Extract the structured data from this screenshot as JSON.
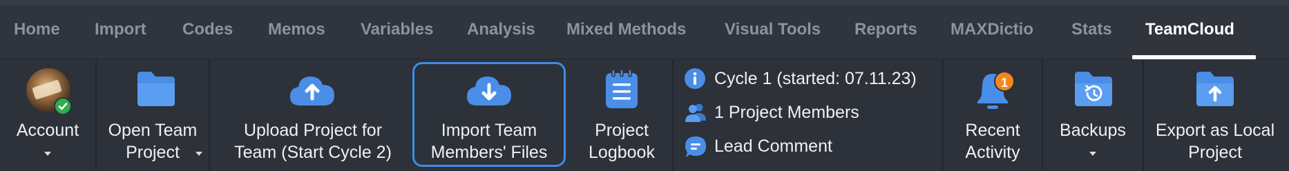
{
  "tabs": [
    {
      "label": "Home",
      "active": false
    },
    {
      "label": "Import",
      "active": false
    },
    {
      "label": "Codes",
      "active": false
    },
    {
      "label": "Memos",
      "active": false
    },
    {
      "label": "Variables",
      "active": false
    },
    {
      "label": "Analysis",
      "active": false
    },
    {
      "label": "Mixed Methods",
      "active": false
    },
    {
      "label": "Visual Tools",
      "active": false
    },
    {
      "label": "Reports",
      "active": false
    },
    {
      "label": "MAXDictio",
      "active": false
    },
    {
      "label": "Stats",
      "active": false
    },
    {
      "label": "TeamCloud",
      "active": true
    }
  ],
  "ribbon": {
    "account": {
      "label": "Account",
      "icon": "user-avatar-icon",
      "status_icon": "check-icon"
    },
    "open_team_project": {
      "line1": "Open Team",
      "line2": "Project",
      "icon": "folder-icon"
    },
    "upload_project": {
      "line1": "Upload Project for",
      "line2": "Team (Start Cycle 2)",
      "icon": "cloud-upload-icon"
    },
    "import_team_files": {
      "line1": "Import Team",
      "line2": "Members' Files",
      "icon": "cloud-download-icon"
    },
    "project_logbook": {
      "line1": "Project",
      "line2": "Logbook",
      "icon": "notepad-icon"
    },
    "info": {
      "cycle": "Cycle 1 (started: 07.11.23)",
      "members": "1 Project Members",
      "lead_comment": "Lead Comment"
    },
    "recent_activity": {
      "line1": "Recent",
      "line2": "Activity",
      "icon": "bell-icon",
      "badge": "1"
    },
    "backups": {
      "label": "Backups",
      "icon": "backup-folder-icon"
    },
    "export_local": {
      "line1": "Export as Local",
      "line2": "Project",
      "icon": "folder-export-icon"
    }
  },
  "colors": {
    "background": "#2c313a",
    "accent": "#3d8ee6",
    "icon_blue": "#4a8ee8",
    "badge_orange": "#f2881a",
    "check_green": "#2fae4e"
  }
}
